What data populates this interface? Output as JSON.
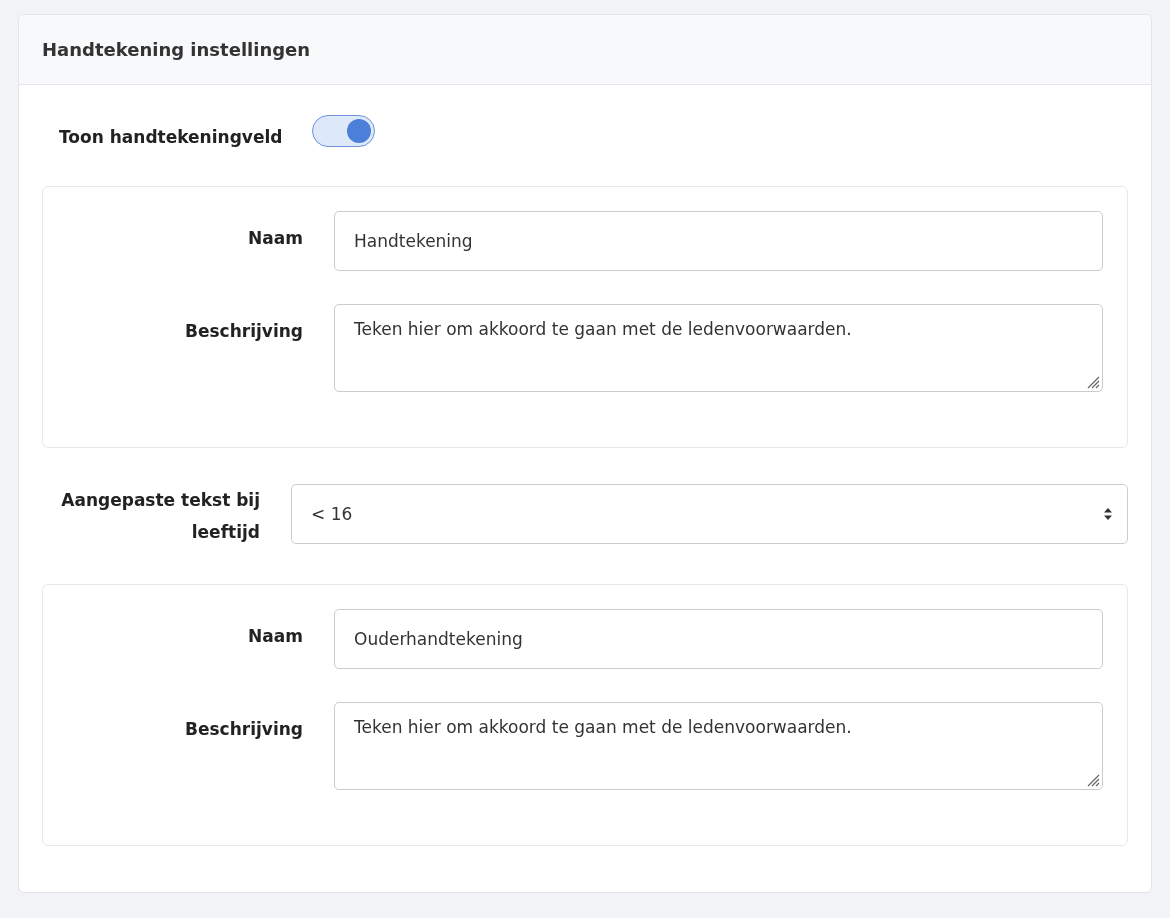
{
  "card": {
    "title": "Handtekening instellingen"
  },
  "toggle": {
    "label": "Toon handtekeningveld",
    "on": true
  },
  "sections": [
    {
      "kind": "fields",
      "fields": [
        {
          "kind": "input",
          "label": "Naam",
          "value": "Handtekening"
        },
        {
          "kind": "textarea",
          "label": "Beschrijving",
          "value": "Teken hier om akkoord te gaan met de ledenvoorwaarden."
        }
      ]
    },
    {
      "kind": "select",
      "label": "Aangepaste tekst bij leeftijd",
      "value": "< 16"
    },
    {
      "kind": "fields",
      "fields": [
        {
          "kind": "input",
          "label": "Naam",
          "value": "Ouderhandtekening"
        },
        {
          "kind": "textarea",
          "label": "Beschrijving",
          "value": "Teken hier om akkoord te gaan met de ledenvoorwaarden."
        }
      ]
    }
  ]
}
